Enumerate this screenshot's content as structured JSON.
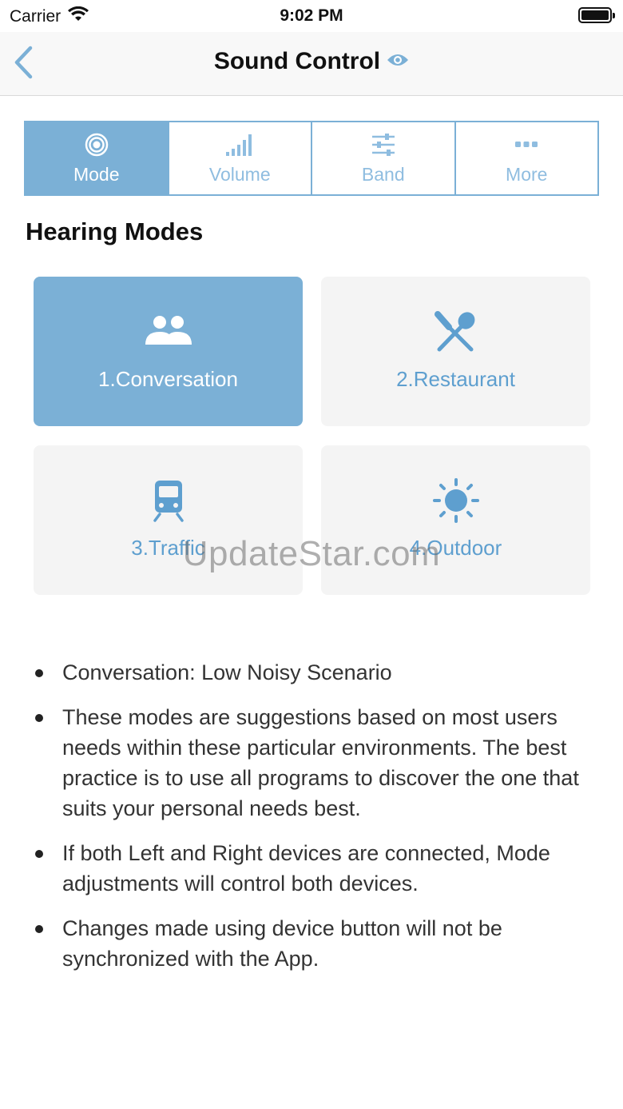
{
  "status_bar": {
    "carrier": "Carrier",
    "time": "9:02 PM"
  },
  "nav": {
    "title": "Sound Control"
  },
  "segments": [
    {
      "label": "Mode",
      "icon": "target-icon",
      "active": true
    },
    {
      "label": "Volume",
      "icon": "signal-bars-icon",
      "active": false
    },
    {
      "label": "Band",
      "icon": "sliders-icon",
      "active": false
    },
    {
      "label": "More",
      "icon": "more-dots-icon",
      "active": false
    }
  ],
  "section": {
    "heading": "Hearing Modes"
  },
  "modes": [
    {
      "label": "1.Conversation",
      "icon": "people-icon",
      "active": true
    },
    {
      "label": "2.Restaurant",
      "icon": "fork-spoon-icon",
      "active": false
    },
    {
      "label": "3.Traffic",
      "icon": "train-icon",
      "active": false
    },
    {
      "label": "4.Outdoor",
      "icon": "sun-icon",
      "active": false
    }
  ],
  "watermark": "UpdateStar.com",
  "info": [
    "Conversation: Low Noisy Scenario",
    "These modes are suggestions based on most users needs within these particular environments. The best practice is to use all programs to discover the one that suits your personal needs best.",
    "If both Left and Right devices are connected, Mode adjustments will control both devices.",
    "Changes made using device button will not be synchronized with the App."
  ],
  "colors": {
    "accent": "#7bb0d6",
    "accent_text": "#5e9fcf",
    "card_bg": "#f4f4f4"
  }
}
